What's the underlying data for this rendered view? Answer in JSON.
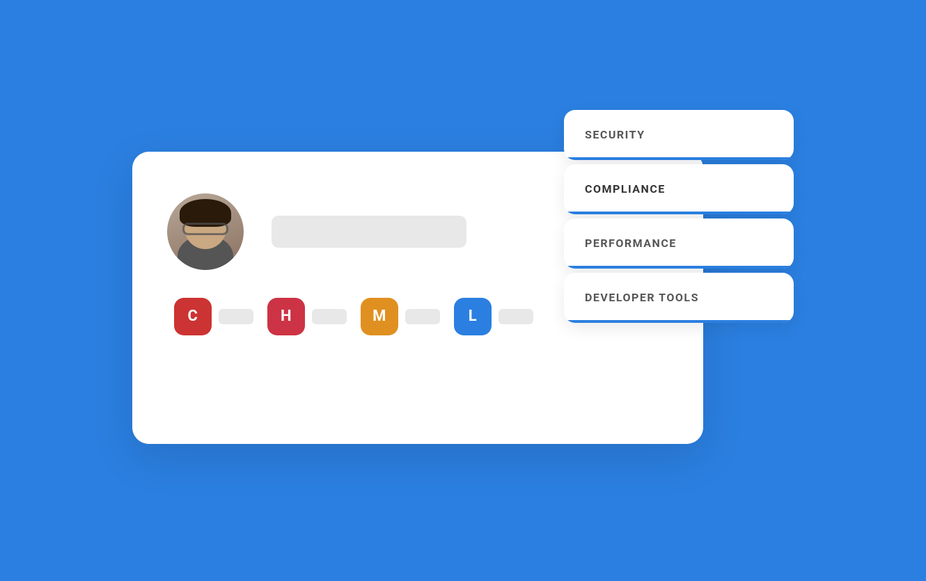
{
  "background_color": "#2B7FE0",
  "card": {
    "name_placeholder": "",
    "users": [
      {
        "initial": "C",
        "color_class": "badge-c"
      },
      {
        "initial": "H",
        "color_class": "badge-h"
      },
      {
        "initial": "M",
        "color_class": "badge-m"
      },
      {
        "initial": "L",
        "color_class": "badge-l"
      }
    ]
  },
  "menu": {
    "items": [
      {
        "label": "SECURITY",
        "active": false
      },
      {
        "label": "COMPLIANCE",
        "active": true
      },
      {
        "label": "PERFORMANCE",
        "active": false
      },
      {
        "label": "DEVELOPER TOOLS",
        "active": false
      }
    ]
  },
  "icons": {
    "user_initial_c": "C",
    "user_initial_h": "H",
    "user_initial_m": "M",
    "user_initial_l": "L"
  }
}
